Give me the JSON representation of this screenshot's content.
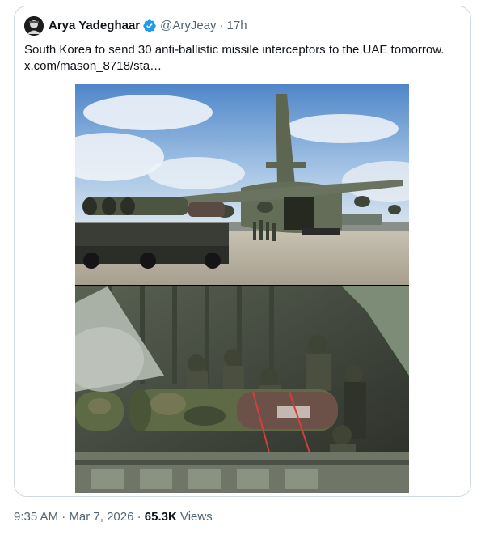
{
  "quoted_tweet": {
    "author_name": "Arya Yadeghaar",
    "handle": "@AryJeay",
    "separator": "·",
    "age": "17h",
    "verified": true,
    "text": "South Korea to send 30 anti-ballistic missile interceptors to the UAE tomorrow.",
    "link_text": "x.com/mason_8718/sta…"
  },
  "tweet_meta": {
    "time": "9:35 AM",
    "dot1": "·",
    "date": "Mar 7, 2026",
    "dot2": "·",
    "views_count": "65.3K",
    "views_label": "Views"
  },
  "colors": {
    "verified_blue": "#1d9bf0",
    "secondary_text": "#536471",
    "border": "#cfd9de"
  }
}
